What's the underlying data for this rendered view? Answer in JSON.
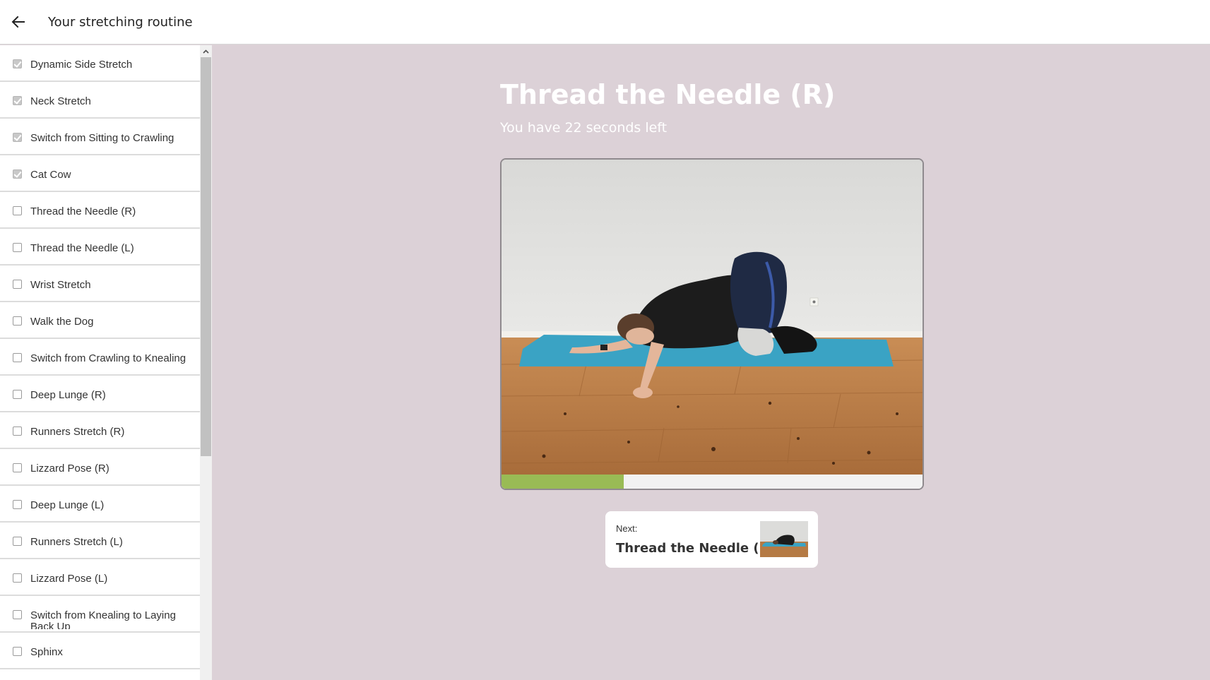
{
  "header": {
    "title": "Your stretching routine",
    "back_icon": "arrow-left-icon"
  },
  "sidebar": {
    "items": [
      {
        "label": "Dynamic Side Stretch",
        "checked": true
      },
      {
        "label": "Neck Stretch",
        "checked": true
      },
      {
        "label": "Switch from Sitting to Crawling",
        "checked": true
      },
      {
        "label": "Cat Cow",
        "checked": true
      },
      {
        "label": "Thread the Needle (R)",
        "checked": false
      },
      {
        "label": "Thread the Needle (L)",
        "checked": false
      },
      {
        "label": "Wrist Stretch",
        "checked": false
      },
      {
        "label": "Walk the Dog",
        "checked": false
      },
      {
        "label": "Switch from Crawling to Knealing",
        "checked": false
      },
      {
        "label": "Deep Lunge (R)",
        "checked": false
      },
      {
        "label": "Runners Stretch (R)",
        "checked": false
      },
      {
        "label": "Lizzard Pose (R)",
        "checked": false
      },
      {
        "label": "Deep Lunge (L)",
        "checked": false
      },
      {
        "label": "Runners Stretch (L)",
        "checked": false
      },
      {
        "label": "Lizzard Pose (L)",
        "checked": false
      },
      {
        "label": "Switch from Knealing to Laying Back Up",
        "checked": false
      },
      {
        "label": "Sphinx",
        "checked": false
      }
    ]
  },
  "exercise": {
    "title": "Thread the Needle (R)",
    "subtitle": "You have 22 seconds left",
    "progress_fraction": 0.29
  },
  "next": {
    "label": "Next:",
    "title": "Thread the Needle (L)"
  },
  "colors": {
    "background": "#dcd1d7",
    "progress": "#99bb55",
    "mat": "#3aa3c4",
    "floor": "#b9804a",
    "wall": "#e3e3e1"
  }
}
